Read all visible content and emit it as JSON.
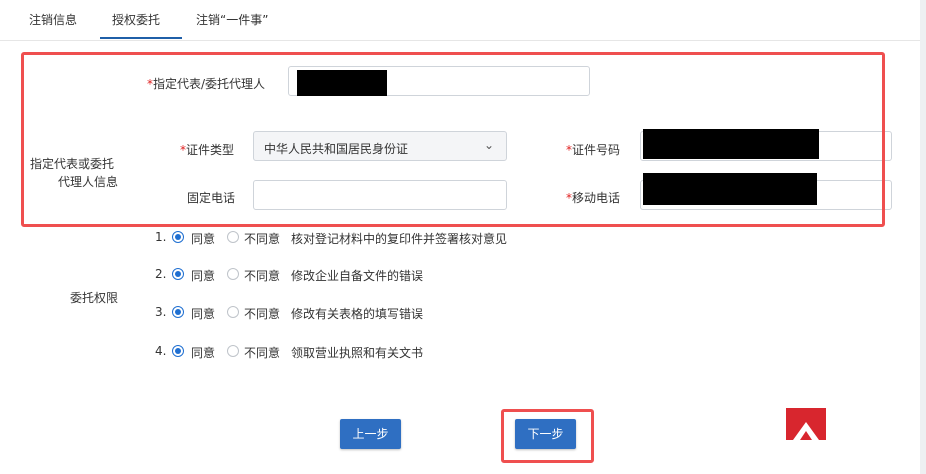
{
  "tabs": [
    {
      "label": "注销信息"
    },
    {
      "label": "授权委托"
    },
    {
      "label": "注销“一件事”"
    }
  ],
  "agent": {
    "name_label": "指定代表/委托代理人",
    "section_label_line1": "指定代表或委托",
    "section_label_line2": "代理人信息",
    "id_type_label": "证件类型",
    "id_type_value": "中华人民共和国居民身份证",
    "id_number_label": "证件号码",
    "phone_label": "固定电话",
    "mobile_label": "移动电话"
  },
  "permissions": {
    "section_label": "委托权限",
    "agree_label": "同意",
    "disagree_label": "不同意",
    "items": [
      {
        "num": "1.",
        "text": "核对登记材料中的复印件并签署核对意见"
      },
      {
        "num": "2.",
        "text": "修改企业自备文件的错误"
      },
      {
        "num": "3.",
        "text": "修改有关表格的填写错误"
      },
      {
        "num": "4.",
        "text": "领取营业执照和有关文书"
      }
    ]
  },
  "buttons": {
    "prev": "上一步",
    "next": "下一步"
  },
  "colors": {
    "accent": "#2f6fc2",
    "highlight": "#ef4f4f",
    "required": "#e02020"
  }
}
